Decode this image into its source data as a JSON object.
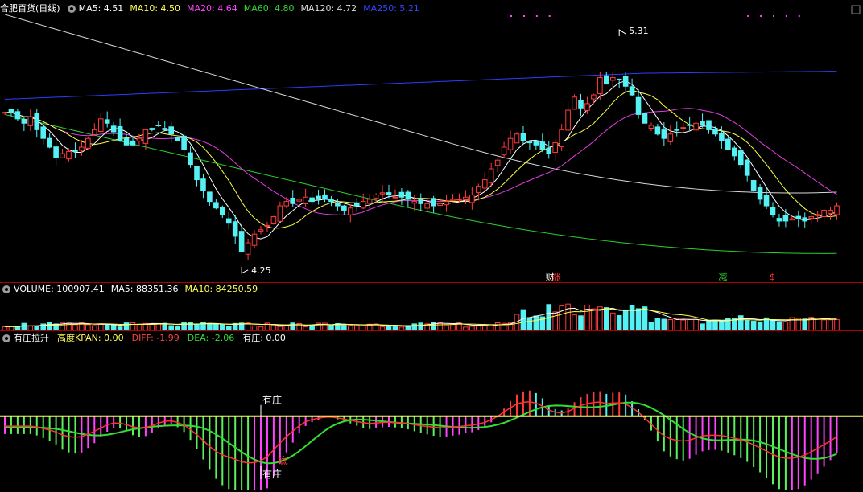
{
  "main": {
    "title": "合肥百货(日线)",
    "ma_labels": [
      {
        "text": "MA5: 4.51",
        "color": "#ffffff"
      },
      {
        "text": "MA10: 4.50",
        "color": "#ffff55"
      },
      {
        "text": "MA20: 4.64",
        "color": "#ff44ff"
      },
      {
        "text": "MA60: 4.80",
        "color": "#33dd33"
      },
      {
        "text": "MA120: 4.72",
        "color": "#dddddd"
      },
      {
        "text": "MA250: 5.21",
        "color": "#3344ff"
      }
    ],
    "high_label": "5.31",
    "low_label": "4.25",
    "markers": [
      {
        "text": "财",
        "color": "#ffffff",
        "day": 85
      },
      {
        "text": "涨",
        "color": "#ff3333",
        "day": 86
      },
      {
        "text": "减",
        "color": "#33dd33",
        "day": 112
      },
      {
        "text": "$",
        "color": "#ff3333",
        "day": 120
      }
    ]
  },
  "volume": {
    "labels": [
      {
        "text": "VOLUME: 100907.41",
        "color": "#ffffff"
      },
      {
        "text": "MA5: 88351.36",
        "color": "#ffffff"
      },
      {
        "text": "MA10: 84250.59",
        "color": "#ffff55"
      }
    ]
  },
  "indicator": {
    "labels": [
      {
        "text": "有庄拉升",
        "color": "#ffffff"
      },
      {
        "text": "高度KPAN: 0.00",
        "color": "#ffff55"
      },
      {
        "text": "DIFF: -1.99",
        "color": "#ff4444"
      },
      {
        "text": "DEA: -2.06",
        "color": "#33dd33"
      },
      {
        "text": "有庄: 0.00",
        "color": "#ffffff"
      }
    ],
    "annotations": [
      {
        "text": "有庄",
        "day": 40,
        "pos": "top"
      },
      {
        "text": "有庄",
        "day": 40,
        "pos": "bottom"
      },
      {
        "text": "底",
        "day": 42,
        "pos": "mid",
        "color": "#ff3333"
      }
    ]
  },
  "chart_data": {
    "type": "candlestick",
    "price_range": [
      4.19,
      5.41
    ],
    "high": {
      "value": 5.31,
      "day": 96
    },
    "low": {
      "value": 4.25,
      "day": 37
    },
    "closes": [
      4.96,
      4.96,
      4.93,
      4.91,
      4.94,
      4.88,
      4.84,
      4.8,
      4.75,
      4.77,
      4.78,
      4.78,
      4.8,
      4.84,
      4.88,
      4.93,
      4.91,
      4.87,
      4.83,
      4.81,
      4.81,
      4.84,
      4.88,
      4.88,
      4.9,
      4.88,
      4.86,
      4.83,
      4.79,
      4.72,
      4.65,
      4.6,
      4.55,
      4.52,
      4.49,
      4.45,
      4.39,
      4.32,
      4.36,
      4.4,
      4.42,
      4.44,
      4.48,
      4.53,
      4.55,
      4.54,
      4.56,
      4.57,
      4.55,
      4.56,
      4.56,
      4.55,
      4.53,
      4.51,
      4.52,
      4.53,
      4.55,
      4.56,
      4.58,
      4.59,
      4.58,
      4.57,
      4.57,
      4.56,
      4.55,
      4.54,
      4.54,
      4.53,
      4.54,
      4.55,
      4.56,
      4.56,
      4.57,
      4.58,
      4.62,
      4.65,
      4.7,
      4.74,
      4.8,
      4.84,
      4.86,
      4.83,
      4.82,
      4.81,
      4.79,
      4.77,
      4.82,
      4.88,
      4.97,
      5.03,
      4.98,
      5.0,
      5.04,
      5.12,
      5.09,
      5.12,
      5.11,
      5.08,
      5.04,
      4.95,
      4.91,
      4.9,
      4.86,
      4.84,
      4.86,
      4.88,
      4.89,
      4.9,
      4.91,
      4.9,
      4.88,
      4.86,
      4.83,
      4.79,
      4.76,
      4.72,
      4.67,
      4.6,
      4.56,
      4.53,
      4.49,
      4.46,
      4.46,
      4.47,
      4.47,
      4.46,
      4.48,
      4.49,
      4.51,
      4.51,
      4.53
    ],
    "volume_range": [
      0,
      260000
    ],
    "diff_range": [
      -4.0,
      3.8
    ]
  }
}
